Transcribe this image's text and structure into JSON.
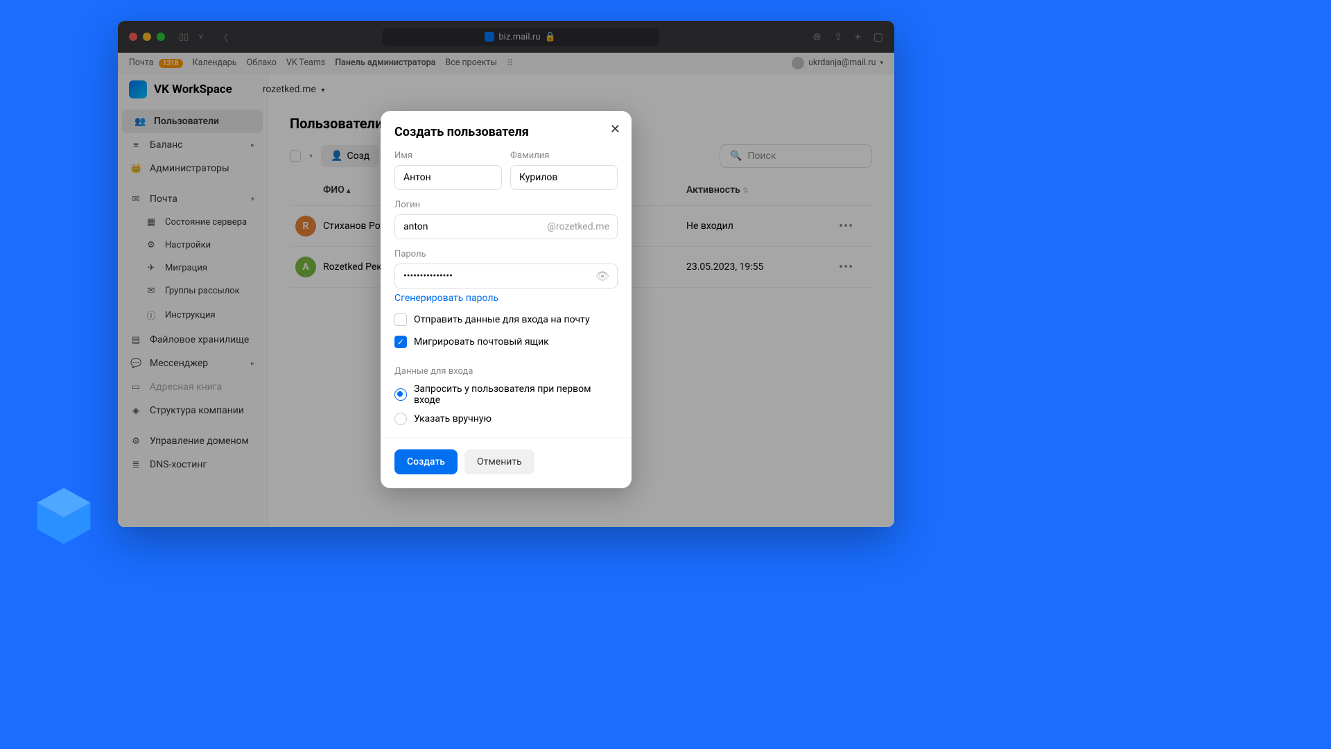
{
  "browser": {
    "url": "biz.mail.ru"
  },
  "topnav": {
    "mail": "Почта",
    "mail_badge": "1318",
    "calendar": "Календарь",
    "cloud": "Облако",
    "teams": "VK Teams",
    "admin": "Панель администратора",
    "projects": "Все проекты",
    "user_email": "ukrdanja@mail.ru"
  },
  "brand": {
    "name": "VK WorkSpace",
    "domain": "rozetked.me"
  },
  "sidebar": {
    "users": "Пользователи",
    "balance": "Баланс",
    "admins": "Администраторы",
    "mail": "Почта",
    "server_state": "Состояние сервера",
    "settings": "Настройки",
    "migration": "Миграция",
    "groups": "Группы рассылок",
    "instruction": "Инструкция",
    "storage": "Файловое хранилище",
    "messenger": "Мессенджер",
    "address_book": "Адресная книга",
    "structure": "Структура компании",
    "domain_mgmt": "Управление доменом",
    "dns": "DNS-хостинг"
  },
  "main": {
    "title": "Пользователи",
    "create_btn": "Созд",
    "search_placeholder": "Поиск",
    "col_name": "ФИО",
    "col_activity": "Активность",
    "rows": [
      {
        "initial": "R",
        "name": "Стиханов Ро",
        "activity": "Не входил"
      },
      {
        "initial": "A",
        "name": "Rozetked Рек",
        "activity": "23.05.2023, 19:55"
      }
    ]
  },
  "modal": {
    "title": "Создать пользователя",
    "name_label": "Имя",
    "name_value": "Антон",
    "surname_label": "Фамилия",
    "surname_value": "Курилов",
    "login_label": "Логин",
    "login_value": "anton",
    "login_suffix": "@rozetked.me",
    "password_label": "Пароль",
    "password_value": "•••••••••••••••",
    "generate": "Сгенерировать пароль",
    "send_email": "Отправить данные для входа на почту",
    "migrate": "Мигрировать почтовый ящик",
    "login_data_label": "Данные для входа",
    "radio_request": "Запросить у пользователя при первом входе",
    "radio_manual": "Указать вручную",
    "create": "Создать",
    "cancel": "Отменить"
  }
}
